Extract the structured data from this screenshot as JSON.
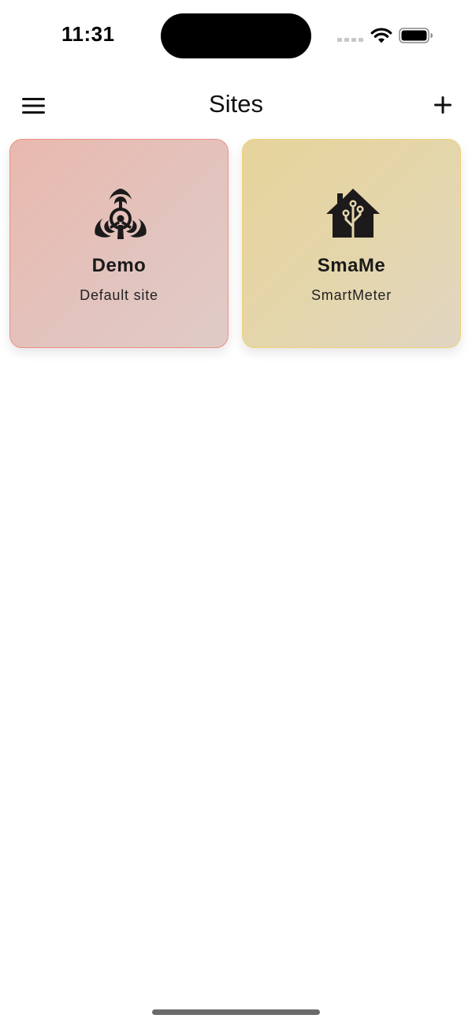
{
  "status_bar": {
    "time": "11:31",
    "icons": [
      "cellular-signal-icon",
      "wifi-icon",
      "battery-icon"
    ]
  },
  "nav": {
    "title": "Sites",
    "left_icon": "hamburger-menu-icon",
    "right_icon": "plus-icon"
  },
  "sites": [
    {
      "title": "Demo",
      "subtitle": "Default site",
      "icon": "biohazard-icon",
      "border_color": "#ec8f84",
      "background_color": "#e6bfb6"
    },
    {
      "title": "SmaMe",
      "subtitle": "SmartMeter",
      "icon": "smart-home-icon",
      "border_color": "#f1d37a",
      "background_color": "#e5d5a8"
    }
  ]
}
